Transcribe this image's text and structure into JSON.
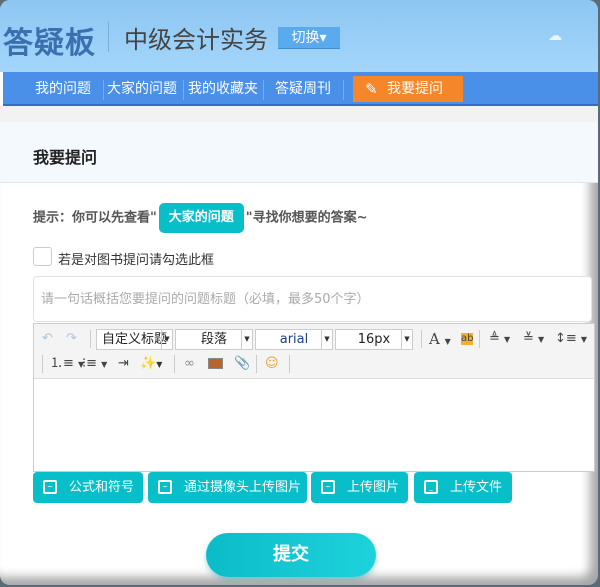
{
  "header": {
    "logo": "答疑板",
    "subject": "中级会计实务",
    "switch_label": "切换▾"
  },
  "nav": {
    "items": [
      "我的问题",
      "大家的问题",
      "我的收藏夹",
      "答疑周刊"
    ],
    "ask_label": "我要提问"
  },
  "section": {
    "title": "我要提问"
  },
  "tip": {
    "prefix": "提示：你可以先查看\"",
    "link": "大家的问题",
    "suffix": "\"寻找你想要的答案~"
  },
  "book_checkbox": {
    "label": "若是对图书提问请勾选此框",
    "checked": false
  },
  "title_input": {
    "placeholder": "请一句话概括您要提问的问题标题（必填，最多50个字）",
    "value": ""
  },
  "toolbar": {
    "heading": "自定义标题",
    "paragraph": "段落",
    "font": "arial",
    "size": "16px"
  },
  "actions": [
    "公式和符号",
    "通过摄像头上传图片",
    "上传图片",
    "上传文件"
  ],
  "submit_label": "提交",
  "colors": {
    "accent": "#08bec8",
    "nav": "#4a8fe8",
    "ask": "#f5862a"
  }
}
